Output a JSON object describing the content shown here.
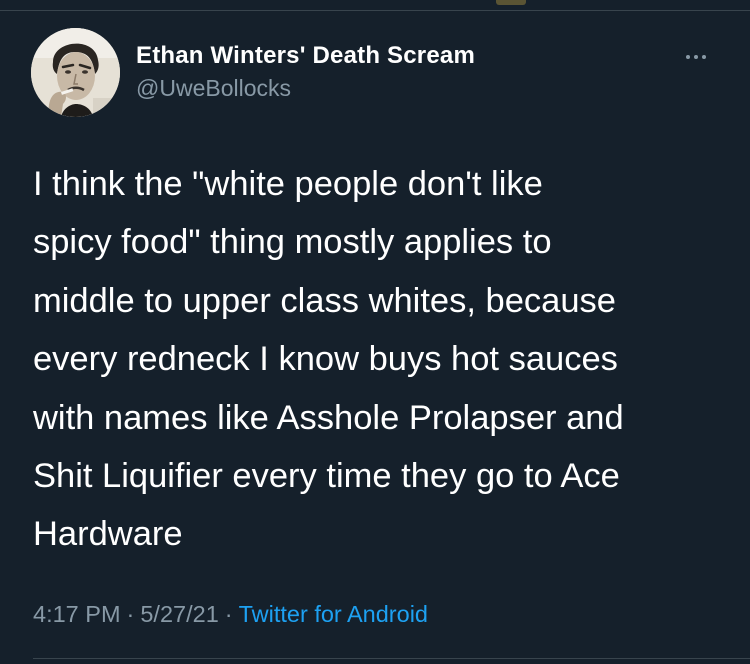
{
  "tweet": {
    "author": {
      "display_name": "Ethan Winters' Death Scream",
      "handle": "@UweBollocks",
      "avatar_icon": "profile-photo"
    },
    "more_icon": "more-horizontal-icon",
    "text_lines": [
      "I think the \"white people don't like",
      "spicy food\" thing mostly applies to",
      "middle to upper class whites, because",
      "every redneck I know buys hot sauces",
      "with names like Asshole Prolapser and",
      "Shit Liquifier every time they go to Ace",
      "Hardware"
    ],
    "meta": {
      "time": "4:17 PM",
      "separator": "·",
      "date": "5/27/21",
      "source": "Twitter for Android"
    }
  },
  "colors": {
    "background": "#15202b",
    "text": "#ffffff",
    "secondary_text": "#8899a6",
    "accent": "#1da1f2",
    "divider": "#38444d"
  }
}
